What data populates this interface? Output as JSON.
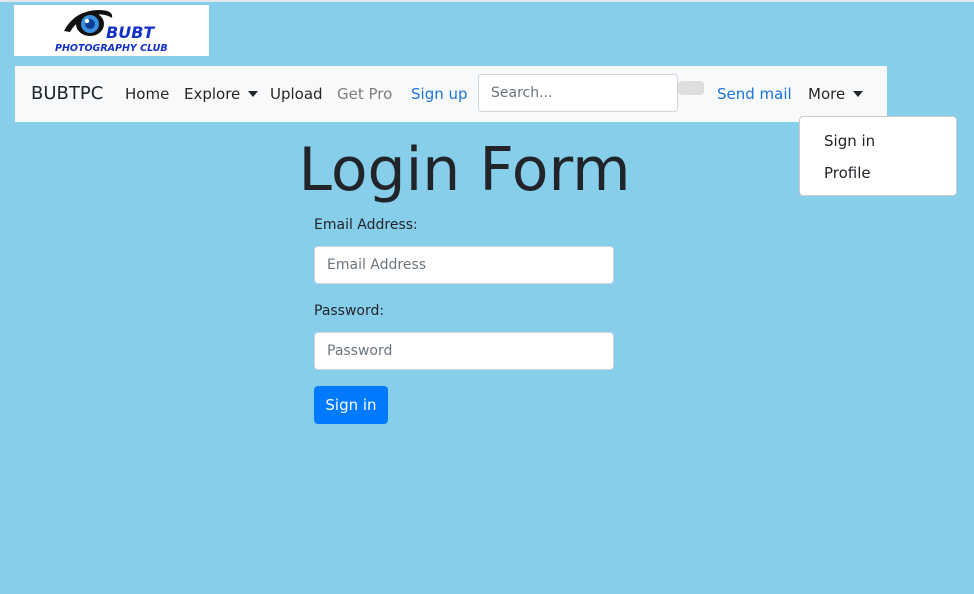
{
  "logo": {
    "line1": "BUBT",
    "line2": "PHOTOGRAPHY CLUB"
  },
  "navbar": {
    "brand": "BUBTPC",
    "links": {
      "home": "Home",
      "explore": "Explore",
      "upload": "Upload",
      "get_pro": "Get Pro",
      "sign_up": "Sign up",
      "send_mail": "Send mail",
      "more": "More"
    },
    "search_placeholder": "Search..."
  },
  "more_menu": {
    "items": [
      "Sign in",
      "Profile"
    ]
  },
  "login_form": {
    "title": "Login Form",
    "email_label": "Email Address:",
    "email_placeholder": "Email Address",
    "password_label": "Password:",
    "password_placeholder": "Password",
    "submit_label": "Sign in"
  },
  "colors": {
    "page_background": "#87ceeb",
    "navbar_background": "#f8f9fa",
    "primary_button": "#007bff",
    "link_blue": "#1a73d9",
    "logo_blue": "#1330c8"
  },
  "icons": [
    "camera-eye-logo-icon",
    "caret-down-icon"
  ]
}
